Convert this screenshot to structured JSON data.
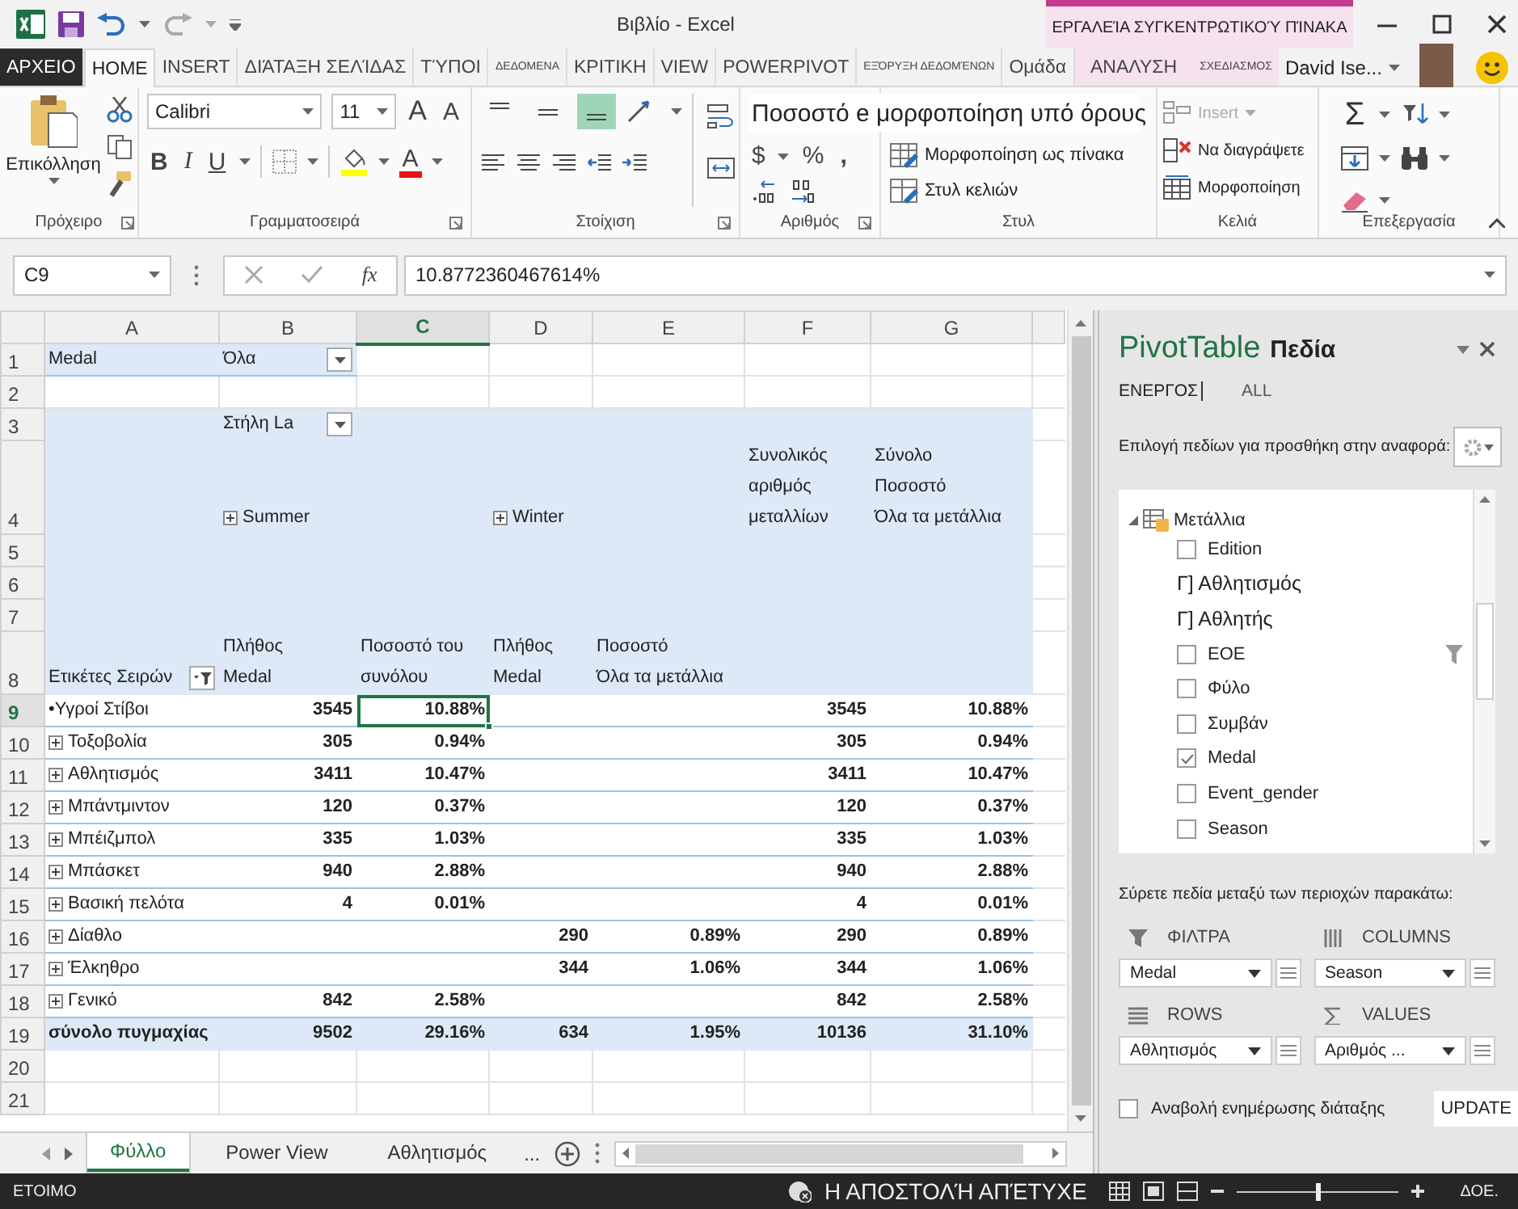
{
  "window": {
    "title": "Βιβλίο - Excel",
    "contextual_group": "ΕΡΓΑΛΕΊΑ ΣΥΓΚΕΝΤΡΩΤΙΚΟΎ ΠΊΝΑΚΑ"
  },
  "ribbon": {
    "tabs": [
      {
        "label": "ΑΡΧΕΙΟ",
        "kind": "file",
        "selected": false
      },
      {
        "label": "HOME",
        "kind": "normal",
        "selected": true
      },
      {
        "label": "INSERT",
        "kind": "normal",
        "selected": false
      },
      {
        "label": "ΔΙΆΤΑΞΗ ΣΕΛΊΔΑΣ",
        "kind": "normal",
        "selected": false
      },
      {
        "label": "ΤΎΠΟΙ",
        "kind": "normal",
        "selected": false
      },
      {
        "label": "ΔΕΔΟΜΕΝΑ",
        "kind": "small",
        "selected": false
      },
      {
        "label": "ΚΡΙΤΙΚΗ",
        "kind": "normal",
        "selected": false
      },
      {
        "label": "VIEW",
        "kind": "normal",
        "selected": false
      },
      {
        "label": "POWERPIVOT",
        "kind": "normal",
        "selected": false
      },
      {
        "label": "ΕΞΌΡΥΞΗ ΔΕΔΟΜΈΝΩΝ",
        "kind": "small",
        "selected": false
      },
      {
        "label": "Ομάδα",
        "kind": "normal",
        "selected": false
      },
      {
        "label": "ΑΝΑΛΥΣΗ",
        "kind": "contextual",
        "selected": false
      },
      {
        "label": "ΣΧΕΔΙΑΣΜΟΣ",
        "kind": "contextual-small",
        "selected": false
      }
    ],
    "user": "David Ise...",
    "groups": [
      {
        "kind": "clipboard",
        "label": "Πρόχειρο",
        "paste": "Επικόλληση"
      },
      {
        "kind": "font",
        "label": "Γραμματοσειρά",
        "font": "Calibri",
        "size": "11",
        "grow": "A",
        "shrink": "A",
        "bold": "B",
        "italic": "I",
        "underline": "U",
        "font_color": "A"
      },
      {
        "kind": "alignment",
        "label": "Στοίχιση",
        "vertical": [
          {
            "selected": false
          },
          {
            "selected": false
          },
          {
            "selected": true
          }
        ]
      },
      {
        "kind": "number",
        "label": "Αριθμός",
        "format": "Ποσοστό e μορφοποίηση υπό όρους",
        "currency": "$",
        "percent": "%",
        "comma": ","
      },
      {
        "kind": "styles",
        "label": "Στυλ",
        "items": [
          "Μορφοποίηση ως πίνακα",
          "Στυλ κελιών"
        ]
      },
      {
        "kind": "cells",
        "label": "Κελιά",
        "items": [
          {
            "label": "Insert",
            "disabled": true
          },
          {
            "label": "Να διαγράψετε",
            "disabled": false
          },
          {
            "label": "Μορφοποίηση",
            "disabled": false
          }
        ]
      },
      {
        "kind": "editing",
        "label": "Επεξεργασία",
        "sum": "Σ"
      }
    ]
  },
  "formula_bar": {
    "name_box": "C9",
    "function_label": "fx",
    "formula": "10.8772360467614%"
  },
  "sheet": {
    "columns": [
      {
        "label": "A",
        "selected": false
      },
      {
        "label": "B",
        "selected": false
      },
      {
        "label": "C",
        "selected": true
      },
      {
        "label": "D",
        "selected": false
      },
      {
        "label": "E",
        "selected": false
      },
      {
        "label": "F",
        "selected": false
      },
      {
        "label": "G",
        "selected": false
      }
    ],
    "rows": [
      {
        "label": "1",
        "selected": false,
        "kind": "filter",
        "cells": [
          "Medal",
          {
            "text": "Όλα",
            "kind": "dropdown"
          }
        ]
      },
      {
        "label": "2",
        "selected": false,
        "kind": "plain"
      },
      {
        "label": "3",
        "selected": false,
        "kind": "pivot",
        "cells": [
          null,
          {
            "text": "Στήλη La",
            "kind": "dropdown"
          }
        ]
      },
      {
        "label": "4",
        "selected": false,
        "kind": "pivot",
        "cells": [
          null,
          {
            "text": "Summer",
            "kind": "expand"
          },
          null,
          {
            "text": "Winter",
            "kind": "expand"
          },
          null,
          "Συνολικός αριθμός\nμεταλλίων",
          "Σύνολο\nΠοσοστό\nΌλα τα μετάλλια"
        ]
      },
      {
        "label": "5",
        "selected": false,
        "kind": "pivot"
      },
      {
        "label": "6",
        "selected": false,
        "kind": "pivot"
      },
      {
        "label": "7",
        "selected": false,
        "kind": "pivot"
      },
      {
        "label": "8",
        "selected": false,
        "kind": "pivot",
        "cells": [
          {
            "text": "Ετικέτες Σειρών",
            "kind": "filter"
          },
          "Πλήθος\nMedal",
          "Ποσοστό του\nσυνόλου",
          "Πλήθος\nMedal",
          "Ποσοστό\nΌλα τα μετάλλια"
        ]
      },
      {
        "label": "9",
        "selected": true,
        "kind": "data",
        "cells": [
          "•Υγροί Στίβοι",
          "3545",
          "10.88%",
          null,
          null,
          "3545",
          "10.88%"
        ]
      },
      {
        "label": "10",
        "selected": false,
        "kind": "data",
        "cells": [
          {
            "text": "Τοξοβολία",
            "kind": "expand"
          },
          "305",
          "0.94%",
          null,
          null,
          "305",
          "0.94%"
        ]
      },
      {
        "label": "11",
        "selected": false,
        "kind": "data",
        "cells": [
          {
            "text": "Αθλητισμός",
            "kind": "expand"
          },
          "3411",
          "10.47%",
          null,
          null,
          "3411",
          "10.47%"
        ]
      },
      {
        "label": "12",
        "selected": false,
        "kind": "data",
        "cells": [
          {
            "text": "Μπάντμιντον",
            "kind": "expand"
          },
          "120",
          "0.37%",
          null,
          null,
          "120",
          "0.37%"
        ]
      },
      {
        "label": "13",
        "selected": false,
        "kind": "data",
        "cells": [
          {
            "text": "Μπέιζμπολ",
            "kind": "expand"
          },
          "335",
          "1.03%",
          null,
          null,
          "335",
          "1.03%"
        ]
      },
      {
        "label": "14",
        "selected": false,
        "kind": "data",
        "cells": [
          {
            "text": "Μπάσκετ",
            "kind": "expand"
          },
          "940",
          "2.88%",
          null,
          null,
          "940",
          "2.88%"
        ]
      },
      {
        "label": "15",
        "selected": false,
        "kind": "data",
        "cells": [
          {
            "text": "Βασική πελότα",
            "kind": "expand"
          },
          "4",
          "0.01%",
          null,
          null,
          "4",
          "0.01%"
        ]
      },
      {
        "label": "16",
        "selected": false,
        "kind": "data",
        "cells": [
          {
            "text": "Δίαθλο",
            "kind": "expand"
          },
          null,
          null,
          "290",
          "0.89%",
          "290",
          "0.89%"
        ]
      },
      {
        "label": "17",
        "selected": false,
        "kind": "data",
        "cells": [
          {
            "text": "Έλκηθρο",
            "kind": "expand"
          },
          null,
          null,
          "344",
          "1.06%",
          "344",
          "1.06%"
        ]
      },
      {
        "label": "18",
        "selected": false,
        "kind": "data",
        "cells": [
          {
            "text": "Γενικό",
            "kind": "expand"
          },
          "842",
          "2.58%",
          null,
          null,
          "842",
          "2.58%"
        ]
      },
      {
        "label": "19",
        "selected": false,
        "kind": "total",
        "cells": [
          "σύνολο πυγμαχίας",
          "9502",
          "29.16%",
          "634",
          "1.95%",
          "10136",
          "31.10%"
        ]
      },
      {
        "label": "20",
        "selected": false,
        "kind": "plain"
      },
      {
        "label": "21",
        "selected": false,
        "kind": "plain"
      }
    ]
  },
  "sheet_tabs": {
    "tabs": [
      {
        "label": "Φύλλο",
        "selected": true
      },
      {
        "label": "Power View",
        "selected": false
      },
      {
        "label": "Αθλητισμός",
        "selected": false
      }
    ],
    "more": "..."
  },
  "pivot_pane": {
    "title": "PivotTable",
    "subtitle": "Πεδία",
    "tabs": [
      {
        "label": "ΕΝΕΡΓΟΣ",
        "selected": true
      },
      {
        "label": "ALL",
        "selected": false
      }
    ],
    "prompt": "Επιλογή πεδίων για προσθήκη στην αναφορά:",
    "tree": [
      {
        "label": "Μετάλλια",
        "expanded": true,
        "children": [
          {
            "label": "Edition",
            "kind": "checkbox",
            "checked": false,
            "filtered": false
          },
          {
            "label": "Γ] Αθλητισμός",
            "kind": "text"
          },
          {
            "label": "Γ] Αθλητής",
            "kind": "text"
          },
          {
            "label": "ΕΟΕ",
            "kind": "checkbox",
            "checked": false,
            "filtered": true
          },
          {
            "label": "Φύλο",
            "kind": "checkbox",
            "checked": false,
            "filtered": false
          },
          {
            "label": "Συμβάν",
            "kind": "checkbox",
            "checked": false,
            "filtered": false
          },
          {
            "label": "Medal",
            "kind": "checkbox",
            "checked": true,
            "filtered": false
          },
          {
            "label": "Event_gender",
            "kind": "checkbox",
            "checked": false,
            "filtered": false
          },
          {
            "label": "Season",
            "kind": "checkbox",
            "checked": false,
            "filtered": false
          }
        ]
      }
    ],
    "hint": "Σύρετε πεδία μεταξύ των περιοχών παρακάτω:",
    "areas": [
      {
        "kind": "filters",
        "label": "ΦΙΛΤΡΑ",
        "field": "Medal"
      },
      {
        "kind": "columns",
        "label": "COLUMNS",
        "field": "Season"
      },
      {
        "kind": "rows",
        "label": "ROWS",
        "field": "Αθλητισμός"
      },
      {
        "kind": "values",
        "label": "VALUES",
        "field": "Αριθμός ..."
      }
    ],
    "defer": {
      "label": "Αναβολή ενημέρωσης διάταξης",
      "checked": false
    },
    "update_button": "UPDATE"
  },
  "status_bar": {
    "state": "ΕΤΟΙΜΟ",
    "message": "Η ΑΠΟΣΤΟΛΉ ΑΠΈΤΥΧΕ",
    "zoom": {
      "level": 0.5
    },
    "zoom_label": "ΔΟΕ."
  }
}
